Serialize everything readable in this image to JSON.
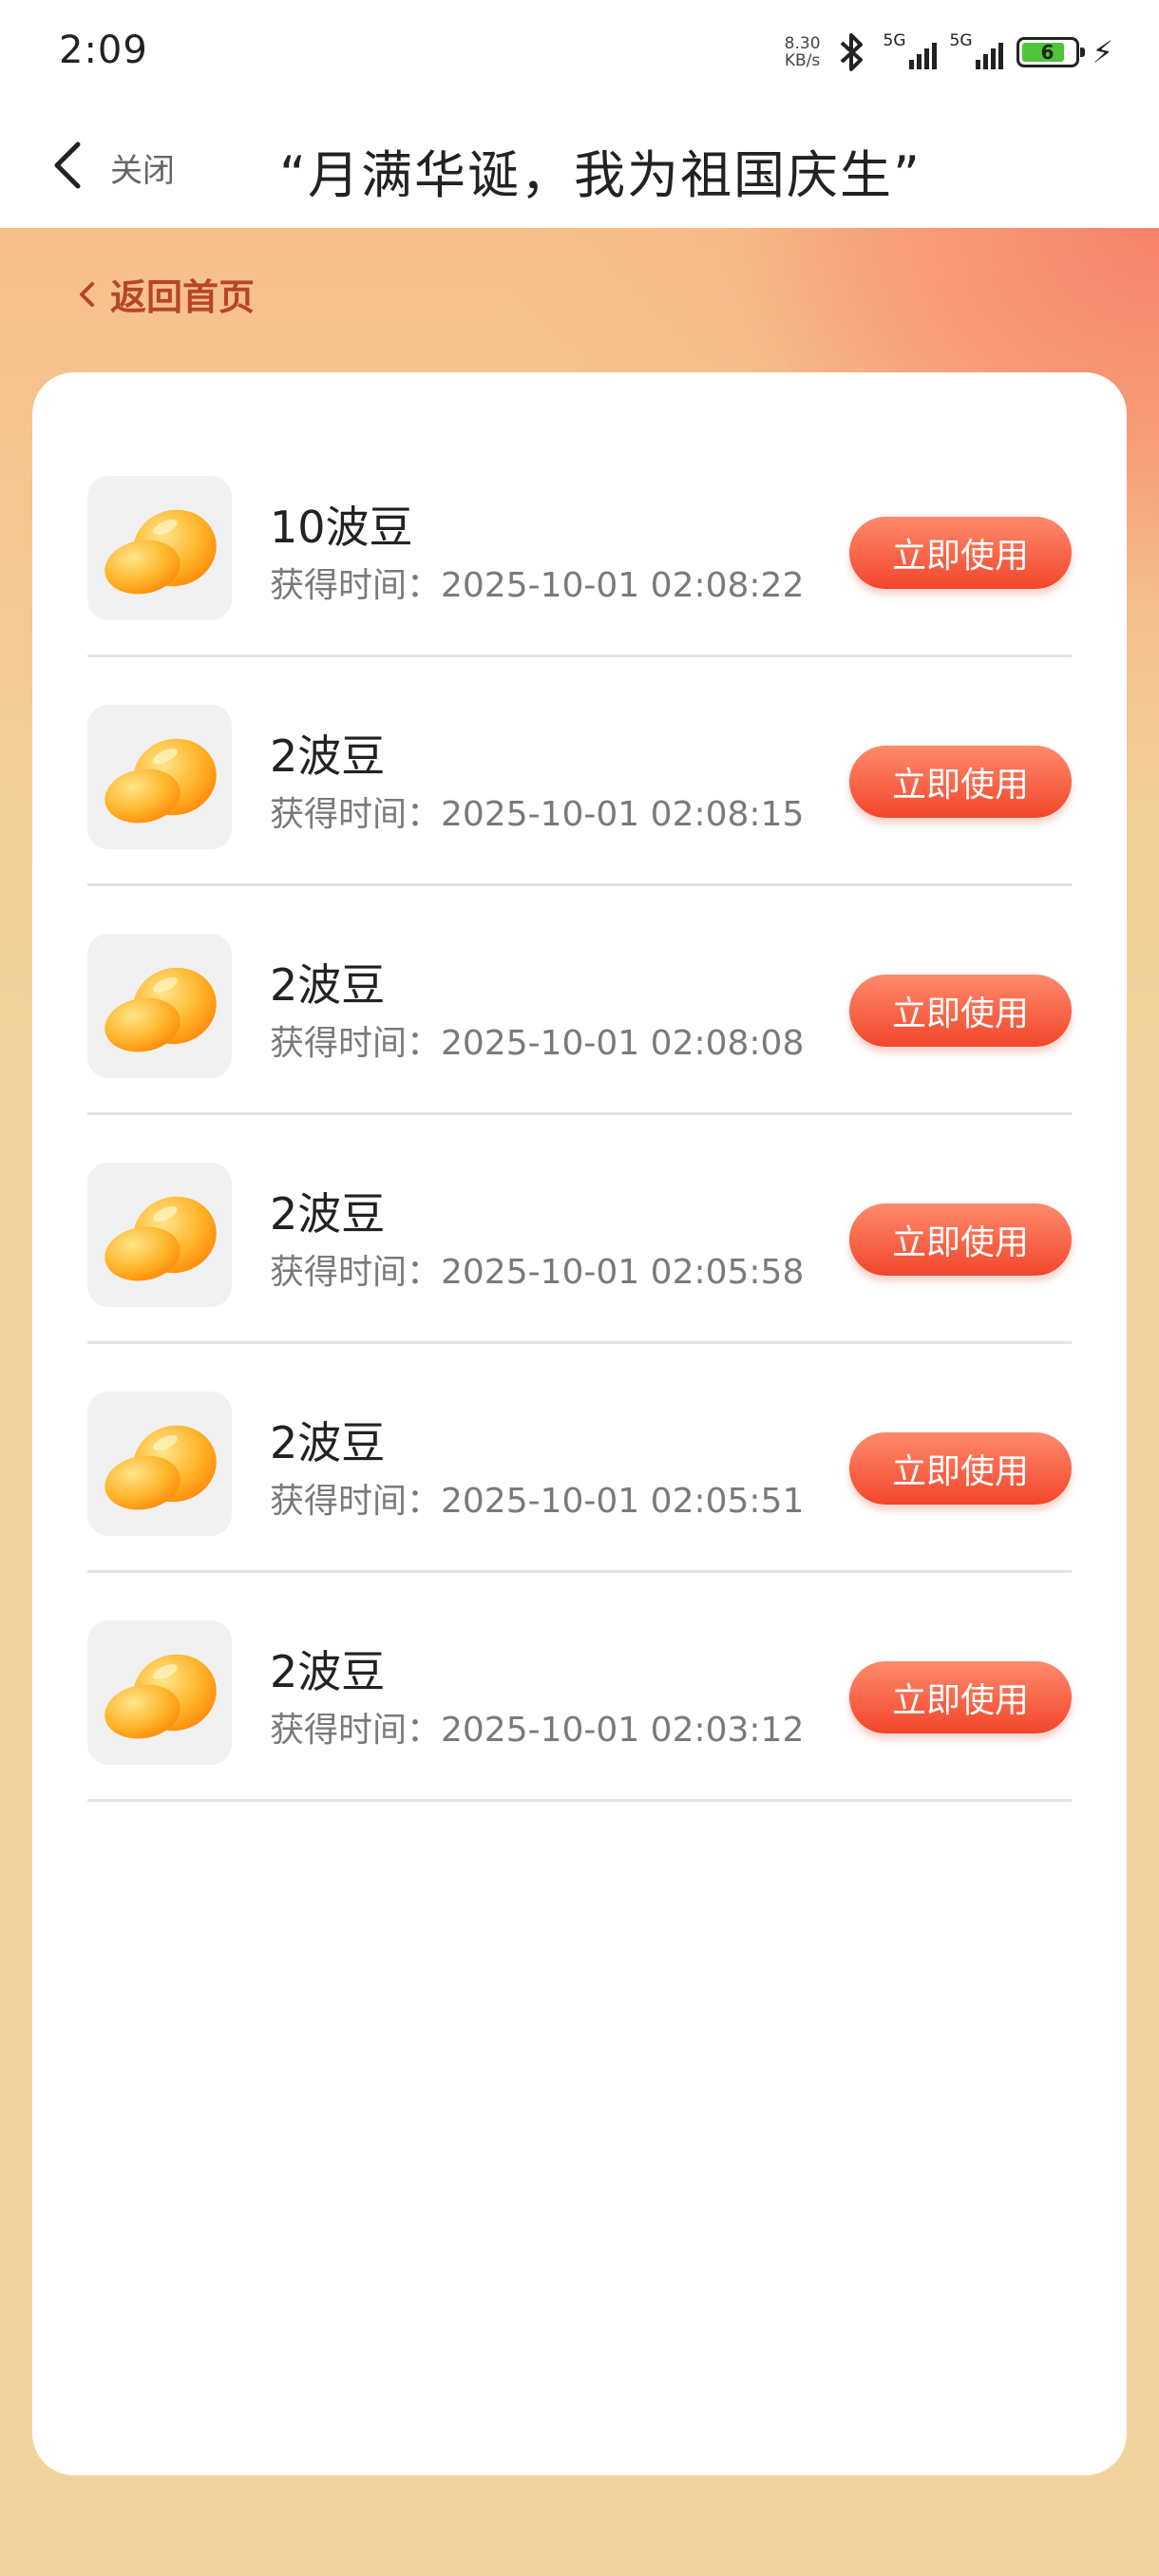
{
  "status_bar": {
    "time": "2:09",
    "net_speed_value": "8.30",
    "net_speed_unit": "KB/s",
    "sim1_label": "5G",
    "sim2_label": "5G",
    "battery_level": "6"
  },
  "header": {
    "close_label": "关闭",
    "title": "“月满华诞，我为祖国庆生”"
  },
  "nav": {
    "home_link": "返回首页"
  },
  "rewards": [
    {
      "title": "10波豆",
      "time": "获得时间：2025-10-01 02:08:22",
      "button": "立即使用"
    },
    {
      "title": "2波豆",
      "time": "获得时间：2025-10-01 02:08:15",
      "button": "立即使用"
    },
    {
      "title": "2波豆",
      "time": "获得时间：2025-10-01 02:08:08",
      "button": "立即使用"
    },
    {
      "title": "2波豆",
      "time": "获得时间：2025-10-01 02:05:58",
      "button": "立即使用"
    },
    {
      "title": "2波豆",
      "time": "获得时间：2025-10-01 02:05:51",
      "button": "立即使用"
    },
    {
      "title": "2波豆",
      "time": "获得时间：2025-10-01 02:03:12",
      "button": "立即使用"
    }
  ],
  "colors": {
    "accent": "#f2462b",
    "home_link": "#b8452b",
    "background": "#f1d49d"
  }
}
